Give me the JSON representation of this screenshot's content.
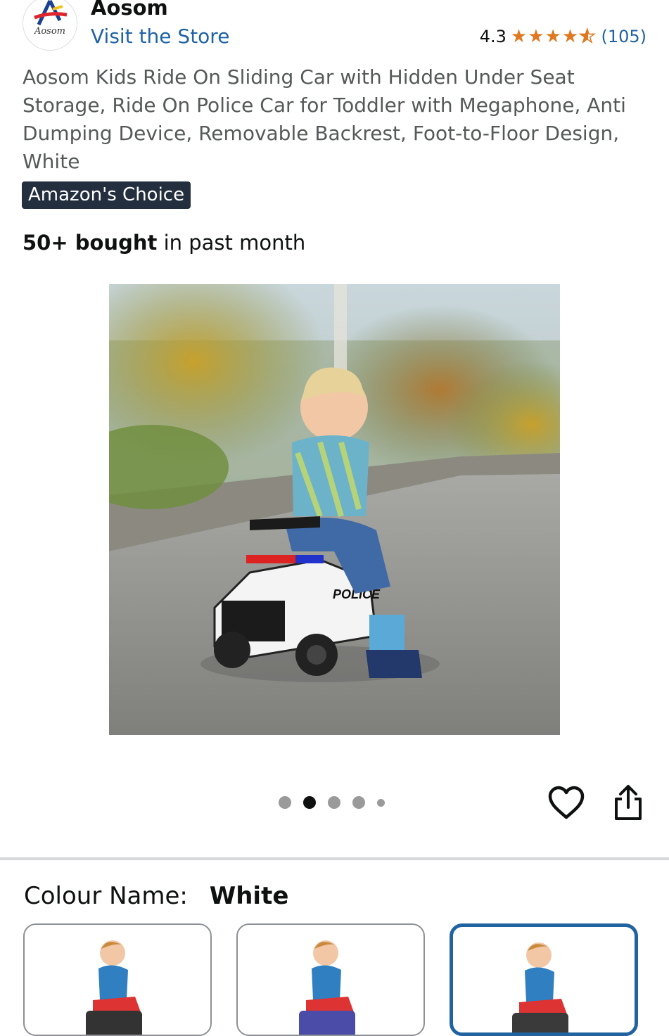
{
  "header": {
    "brand_name": "Aosom",
    "logo_text": "Aosom",
    "store_link": "Visit the Store",
    "rating_value": "4.3",
    "rating_stars": 4.3,
    "review_count": "(105)"
  },
  "product": {
    "title": "Aosom Kids Ride On Sliding Car with Hidden Under Seat Storage, Ride On Police Car for Toddler with Megaphone, Anti Dumping Device, Removable Backrest, Foot-to-Floor Design, White",
    "badge": "Amazon's Choice",
    "bought_bold": "50+ bought",
    "bought_rest": " in past month",
    "car_label": "POLICE"
  },
  "gallery": {
    "image_count": 5,
    "active_index": 1
  },
  "colour": {
    "label": "Colour Name:",
    "value": "White",
    "selected_index": 2
  },
  "colors": {
    "link": "#1f63a6",
    "star": "#de7921",
    "badge_bg": "#232f3e",
    "selected_border": "#2162a1"
  }
}
